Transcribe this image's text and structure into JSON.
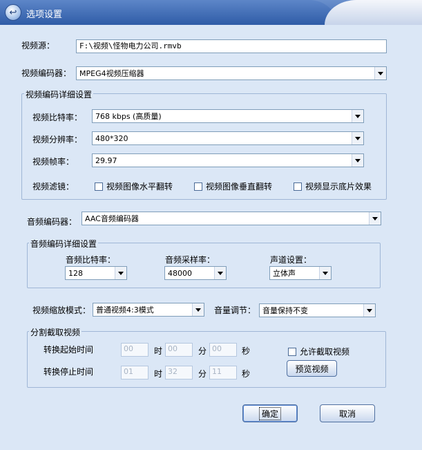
{
  "window": {
    "title": "选项设置"
  },
  "video_source": {
    "label": "视频源：",
    "value": "F:\\视频\\怪物电力公司.rmvb"
  },
  "video_encoder": {
    "label": "视频编码器：",
    "value": "MPEG4视频压缩器"
  },
  "video_detail": {
    "title": "视频编码详细设置",
    "bitrate": {
      "label": "视频比特率：",
      "value": "768 kbps (高质量)"
    },
    "resolution": {
      "label": "视频分辨率：",
      "value": "480*320"
    },
    "framerate": {
      "label": "视频帧率：",
      "value": "29.97"
    },
    "filters": {
      "label": "视频滤镜：",
      "hflip": "视频图像水平翻转",
      "vflip": "视频图像垂直翻转",
      "negative": "视频显示底片效果"
    }
  },
  "audio_encoder": {
    "label": "音频编码器：",
    "value": "AAC音频编码器"
  },
  "audio_detail": {
    "title": "音频编码详细设置",
    "bitrate": {
      "label": "音频比特率：",
      "value": "128"
    },
    "samplerate": {
      "label": "音频采样率：",
      "value": "48000"
    },
    "channels": {
      "label": "声道设置：",
      "value": "立体声"
    }
  },
  "scale_mode": {
    "label": "视频缩放模式：",
    "value": "普通视频4:3模式"
  },
  "volume": {
    "label": "音量调节：",
    "value": "音量保持不变"
  },
  "clip": {
    "title": "分割截取视频",
    "start_label": "转换起始时间",
    "end_label": "转换停止时间",
    "start": {
      "h": "00",
      "m": "00",
      "s": "00"
    },
    "end": {
      "h": "01",
      "m": "32",
      "s": "11"
    },
    "unit_h": "时",
    "unit_m": "分",
    "unit_s": "秒",
    "allow_clip": "允许截取视频",
    "preview_button": "预览视频"
  },
  "buttons": {
    "ok": "确定",
    "cancel": "取消"
  },
  "icons": {
    "app": "app-icon",
    "dropdown": "chevron-down-icon"
  }
}
